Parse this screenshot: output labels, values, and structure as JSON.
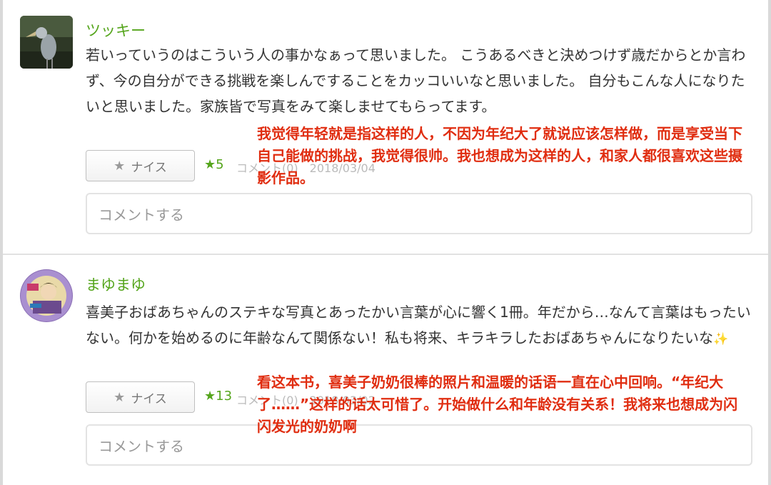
{
  "comments": [
    {
      "username": "ツッキー",
      "body": "若いっていうのはこういう人の事かなぁって思いました。 こうあるべきと決めつけず歳だからとか言わず、今の自分ができる挑戦を楽しんですることをカッコいいなと思いました。 自分もこんな人になりたいと思いました。家族皆で写真をみて楽しませてもらってます。",
      "nice_label": "ナイス",
      "nice_count": "★5",
      "meta": "コメント(0)　2018/03/04",
      "comment_placeholder": "コメントする",
      "translation": "我觉得年轻就是指这样的人，不因为年纪大了就说应该怎样做，而是享受当下自己能做的挑战，我觉得很帅。我也想成为这样的人，和家人都很喜欢这些摄影作品。"
    },
    {
      "username": "まゆまゆ",
      "body": "喜美子おばあちゃんのステキな写真とあったかい言葉が心に響く1冊。年だから…なんて言葉はもったいない。何かを始めるのに年齢なんて関係ない！私も将来、キラキラしたおばあちゃんになりたいな",
      "sparkle": "✨",
      "nice_label": "ナイス",
      "nice_count": "★13",
      "meta": "コメント(0)　2018/03/02",
      "comment_placeholder": "コメントする",
      "translation": "看这本书，喜美子奶奶很棒的照片和温暖的话语一直在心中回响。“年纪大了……”这样的话太可惜了。开始做什么和年龄没有关系！我将来也想成为闪闪发光的奶奶啊"
    }
  ],
  "colors": {
    "username": "#55a51c",
    "translation": "#e02d10",
    "body_text": "#333333"
  },
  "icons": [
    "star-icon"
  ]
}
